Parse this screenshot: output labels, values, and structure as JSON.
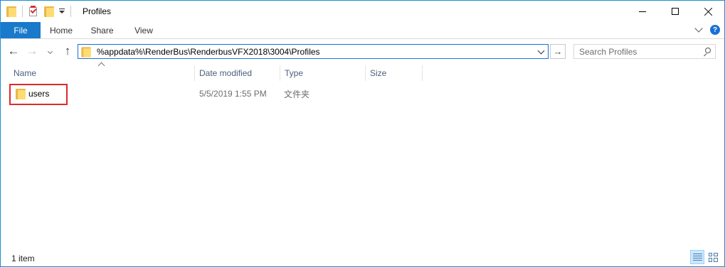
{
  "window": {
    "title": "Profiles",
    "controls": {
      "minimize_icon": "minimize-icon",
      "maximize_icon": "maximize-icon",
      "close_icon": "close-icon"
    }
  },
  "ribbon": {
    "tabs": [
      {
        "label": "File",
        "active": true
      },
      {
        "label": "Home"
      },
      {
        "label": "Share"
      },
      {
        "label": "View"
      }
    ],
    "help_label": "?"
  },
  "navigation": {
    "back_glyph": "←",
    "forward_glyph": "→",
    "up_glyph": "↑",
    "go_glyph": "→",
    "address": "%appdata%\\RenderBus\\RenderbusVFX2018\\3004\\Profiles",
    "search_placeholder": "Search Profiles"
  },
  "columns": [
    {
      "label": "Name",
      "sorted": "ascending"
    },
    {
      "label": "Date modified"
    },
    {
      "label": "Type"
    },
    {
      "label": "Size"
    }
  ],
  "files": [
    {
      "name": "users",
      "date_modified": "5/5/2019 1:55 PM",
      "type": "文件夹",
      "size": "",
      "highlighted": true
    }
  ],
  "status": {
    "item_count": "1 item",
    "view_mode": "details"
  },
  "colors": {
    "accent": "#1979ca",
    "highlight_box": "#e0282b",
    "folder": "#ffdb73"
  }
}
